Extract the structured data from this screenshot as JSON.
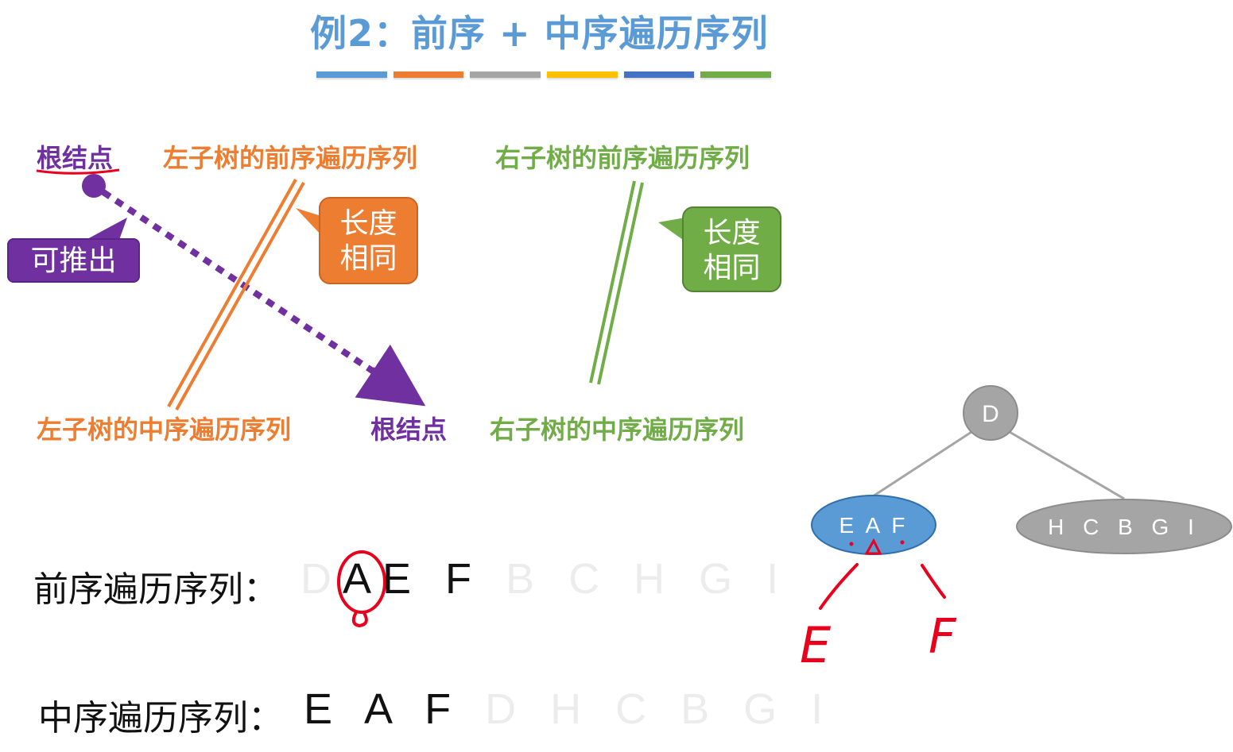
{
  "title": "例2：前序 + 中序遍历序列",
  "palette": [
    "#5b9bd5",
    "#ed7d31",
    "#a5a5a5",
    "#ffc000",
    "#4472c4",
    "#70ad47"
  ],
  "top_row": {
    "root": "根结点",
    "left_pre": "左子树的前序遍历序列",
    "right_pre": "右子树的前序遍历序列"
  },
  "bottom_row": {
    "left_in": "左子树的中序遍历序列",
    "root": "根结点",
    "right_in": "右子树的中序遍历序列"
  },
  "callouts": {
    "left_same_length_1": "长度",
    "left_same_length_2": "相同",
    "right_same_length_1": "长度",
    "right_same_length_2": "相同",
    "deduce": "可推出"
  },
  "preorder": {
    "label": "前序遍历序列：",
    "faded_first": "D",
    "highlight": "A",
    "active": "E F",
    "faded_rest": "B C H G I"
  },
  "inorder": {
    "label": "中序遍历序列：",
    "active": "E A F",
    "faded_rest": "D H C B G I"
  },
  "tree": {
    "root": "D",
    "left": "E A F",
    "right": "H C B G I",
    "hand_left": "E",
    "hand_right": "F"
  },
  "colors": {
    "purple": "#7030a0",
    "orange": "#ed7d31",
    "green": "#70ad47",
    "blue_node": "#5b9bd5",
    "gray_node": "#a5a5a5",
    "ink_red": "#e8001c"
  }
}
